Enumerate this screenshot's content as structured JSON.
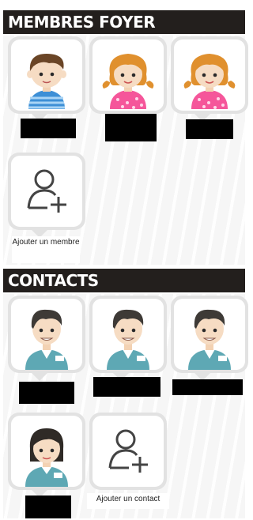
{
  "household": {
    "title": "MEMBRES FOYER",
    "members": [
      {
        "name": "",
        "avatar": "boy-avatar-icon"
      },
      {
        "name": "",
        "avatar": "girl-avatar-icon"
      },
      {
        "name": "",
        "avatar": "girl-avatar-icon"
      }
    ],
    "add_label": "Ajouter un membre"
  },
  "contacts": {
    "title": "CONTACTS",
    "people": [
      {
        "name": "",
        "avatar": "man-avatar-icon"
      },
      {
        "name": "",
        "avatar": "man-avatar-icon"
      },
      {
        "name": "",
        "avatar": "man-avatar-icon"
      },
      {
        "name": "",
        "avatar": "woman-avatar-icon"
      }
    ],
    "add_label": "Ajouter un contact"
  },
  "colors": {
    "header_bg": "#231f1d",
    "tile_border": "#e2e2e2",
    "redaction": "#000000"
  }
}
